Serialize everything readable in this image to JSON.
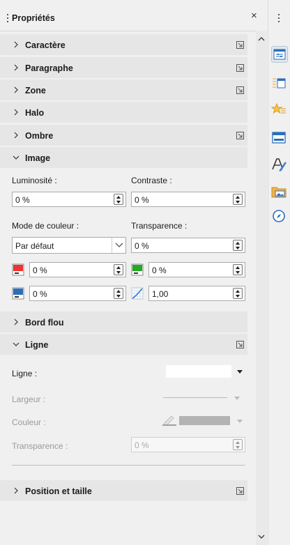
{
  "panel": {
    "title": "Propriétés",
    "close_symbol": "×"
  },
  "sections": {
    "caractere": "Caractère",
    "paragraphe": "Paragraphe",
    "zone": "Zone",
    "halo": "Halo",
    "ombre": "Ombre",
    "image": "Image",
    "bord_flou": "Bord flou",
    "ligne": "Ligne",
    "position": "Position et taille"
  },
  "image": {
    "luminosite_label": "Luminosité :",
    "luminosite_value": "0 %",
    "contraste_label": "Contraste :",
    "contraste_value": "0 %",
    "mode_label": "Mode de couleur :",
    "mode_value": "Par défaut",
    "transparence_label": "Transparence :",
    "transparence_value": "0 %",
    "rouge_value": "0 %",
    "vert_value": "0 %",
    "bleu_value": "0 %",
    "gamma_value": "1,00"
  },
  "ligne": {
    "ligne_label": "Ligne :",
    "largeur_label": "Largeur :",
    "couleur_label": "Couleur :",
    "transparence_label": "Transparence :",
    "transparence_value": "0 %"
  },
  "colors": {
    "section_bg": "#e6e6e6",
    "rail_active": "#dfe7f0",
    "accent_blue": "#2a6ebb"
  }
}
